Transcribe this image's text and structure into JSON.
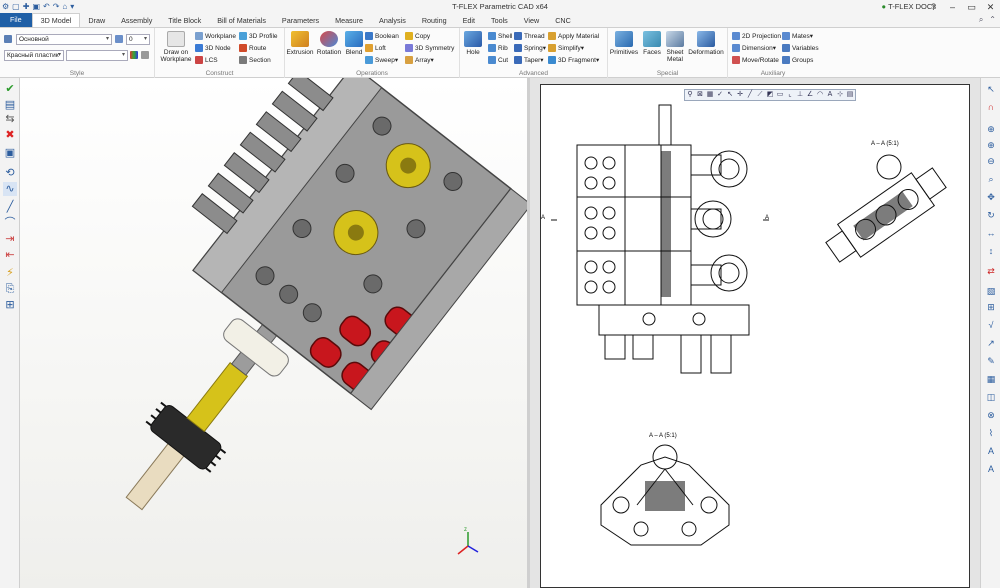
{
  "titlebar": {
    "app_title": "T-FLEX Parametric CAD x64",
    "docs_label": "T-FLEX DOCs",
    "quick_access": [
      "⚙",
      "▢",
      "✚",
      "▣",
      "↶",
      "↷",
      "⌂",
      "▾"
    ],
    "win_buttons": [
      "?",
      "–",
      "▭",
      "✕"
    ]
  },
  "tabs": [
    "File",
    "3D Model",
    "Draw",
    "Assembly",
    "Title Block",
    "Bill of Materials",
    "Parameters",
    "Measure",
    "Analysis",
    "Routing",
    "Edit",
    "Tools",
    "View",
    "CNC"
  ],
  "active_tab": "3D Model",
  "ribbon": {
    "style": {
      "label": "Style",
      "layer_value": "Основной",
      "number_value": "0",
      "material_value": "Красный пластик"
    },
    "construct": {
      "label": "Construct",
      "draw_on_workplane": "Draw on Workplane",
      "items": [
        "Workplane",
        "3D Node",
        "LCS",
        "3D Profile",
        "Route",
        "Section"
      ]
    },
    "operations": {
      "label": "Operations",
      "big": [
        "Extrusion",
        "Rotation",
        "Blend"
      ],
      "items": [
        "Boolean",
        "Loft",
        "Sweep",
        "Copy",
        "3D Symmetry",
        "Array"
      ]
    },
    "advanced": {
      "label": "Advanced",
      "big": [
        "Hole"
      ],
      "items": [
        "Shell",
        "Rib",
        "Cut",
        "Thread",
        "Spring",
        "Taper",
        "Apply Material",
        "Simplify",
        "3D Fragment"
      ]
    },
    "special": {
      "label": "Special",
      "big": [
        "Primitives",
        "Faces",
        "Sheet Metal",
        "Deformation"
      ]
    },
    "auxiliary": {
      "label": "Auxiliary",
      "items": [
        "2D Projection",
        "Dimension",
        "Move/Rotate",
        "Mates",
        "Variables",
        "Groups"
      ]
    }
  },
  "drawing": {
    "section_label_top": "A – A (5:1)",
    "section_label_bottom": "A – A (5:1)",
    "cut_label": "A"
  },
  "colors": {
    "accent": "#1f5fa6",
    "body_gray": "#9a9a9a",
    "red_part": "#c8161d",
    "yellow_part": "#d6c21a"
  }
}
